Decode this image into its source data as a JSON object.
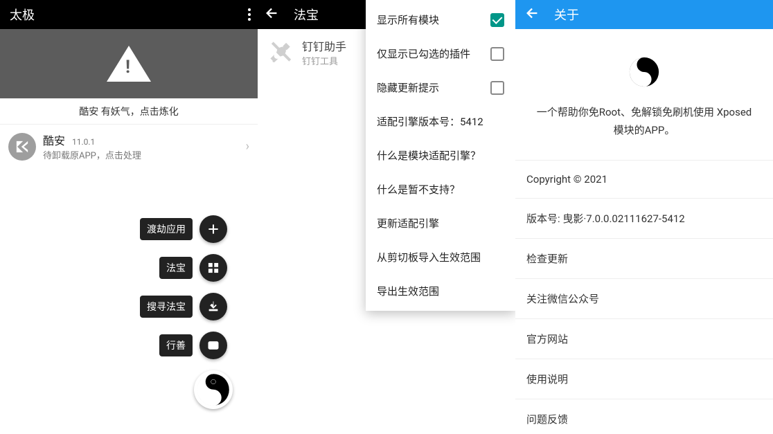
{
  "panel1": {
    "title": "太极",
    "banner_text": "酷安 有妖气，点击炼化",
    "app": {
      "name": "酷安",
      "version": "11.0.1",
      "sub": "待卸载原APP，点击处理"
    },
    "fab": [
      {
        "label": "渡劫应用"
      },
      {
        "label": "法宝"
      },
      {
        "label": "搜寻法宝"
      },
      {
        "label": "行善"
      }
    ]
  },
  "panel2": {
    "title": "法宝",
    "module": {
      "name": "钉钉助手",
      "sub": "钉钉工具"
    },
    "menu": [
      {
        "label": "显示所有模块",
        "type": "check",
        "checked": true
      },
      {
        "label": "仅显示已勾选的插件",
        "type": "check",
        "checked": false
      },
      {
        "label": "隐藏更新提示",
        "type": "check",
        "checked": false
      },
      {
        "label": "适配引擎版本号：5412",
        "type": "text"
      },
      {
        "label": "什么是模块适配引擎？",
        "type": "text"
      },
      {
        "label": "什么是暂不支持？",
        "type": "text"
      },
      {
        "label": "更新适配引擎",
        "type": "text"
      },
      {
        "label": "从剪切板导入生效范围",
        "type": "text"
      },
      {
        "label": "导出生效范围",
        "type": "text"
      }
    ]
  },
  "panel3": {
    "title": "关于",
    "desc": "一个帮助你免Root、免解锁免刷机使用 Xposed 模块的APP。",
    "rows": [
      "Copyright © 2021",
      "版本号: 曳影·7.0.0.02111627-5412",
      "检查更新",
      "关注微信公众号",
      "官方网站",
      "使用说明",
      "问题反馈"
    ]
  }
}
